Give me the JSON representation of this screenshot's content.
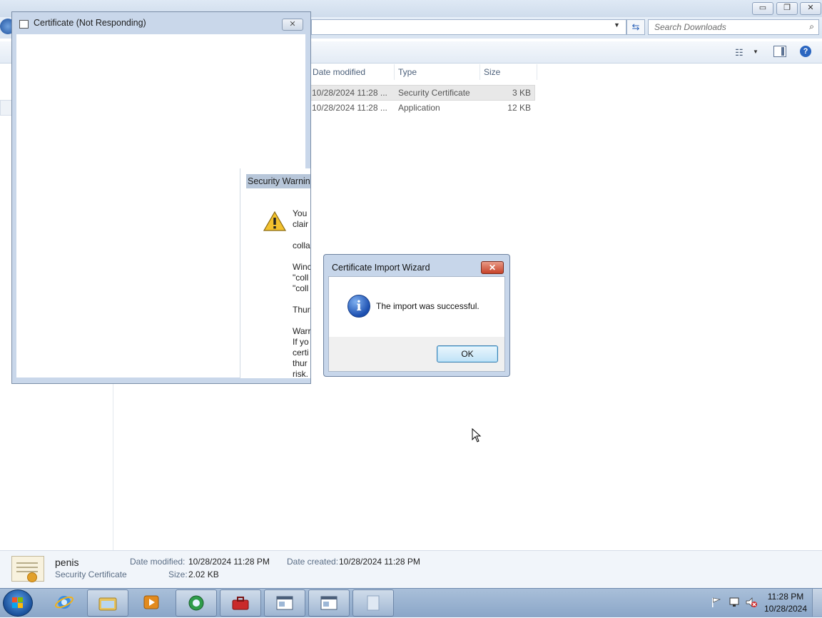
{
  "explorer": {
    "search_placeholder": "Search Downloads",
    "columns": [
      "Date modified",
      "Type",
      "Size"
    ],
    "rows": [
      {
        "date": "10/28/2024 11:28 ...",
        "type": "Security Certificate",
        "size": "3 KB"
      },
      {
        "date": "10/28/2024 11:28 ...",
        "type": "Application",
        "size": "12 KB"
      }
    ],
    "details": {
      "name": "penis",
      "kind": "Security Certificate",
      "date_modified_label": "Date modified:",
      "date_modified": "10/28/2024 11:28 PM",
      "size_label": "Size:",
      "size": "2.02 KB",
      "date_created_label": "Date created:",
      "date_created": "10/28/2024 11:28 PM"
    }
  },
  "cert_window": {
    "title": "Certificate (Not Responding)"
  },
  "security_warning": {
    "title": "Security Warning",
    "lines": [
      "You",
      "clair",
      "colla",
      "Winc",
      "\"coll",
      "\"coll",
      "Thur",
      "Warr",
      "If yo",
      "certi",
      "thur",
      "risk."
    ]
  },
  "wizard": {
    "title": "Certificate Import Wizard",
    "message": "The import was successful.",
    "ok_label": "OK",
    "close_glyph": "✕"
  },
  "taskbar": {
    "time": "11:28 PM",
    "date": "10/28/2024"
  },
  "colors": {
    "accent": "#2b66c0",
    "close_red": "#c7432a"
  }
}
